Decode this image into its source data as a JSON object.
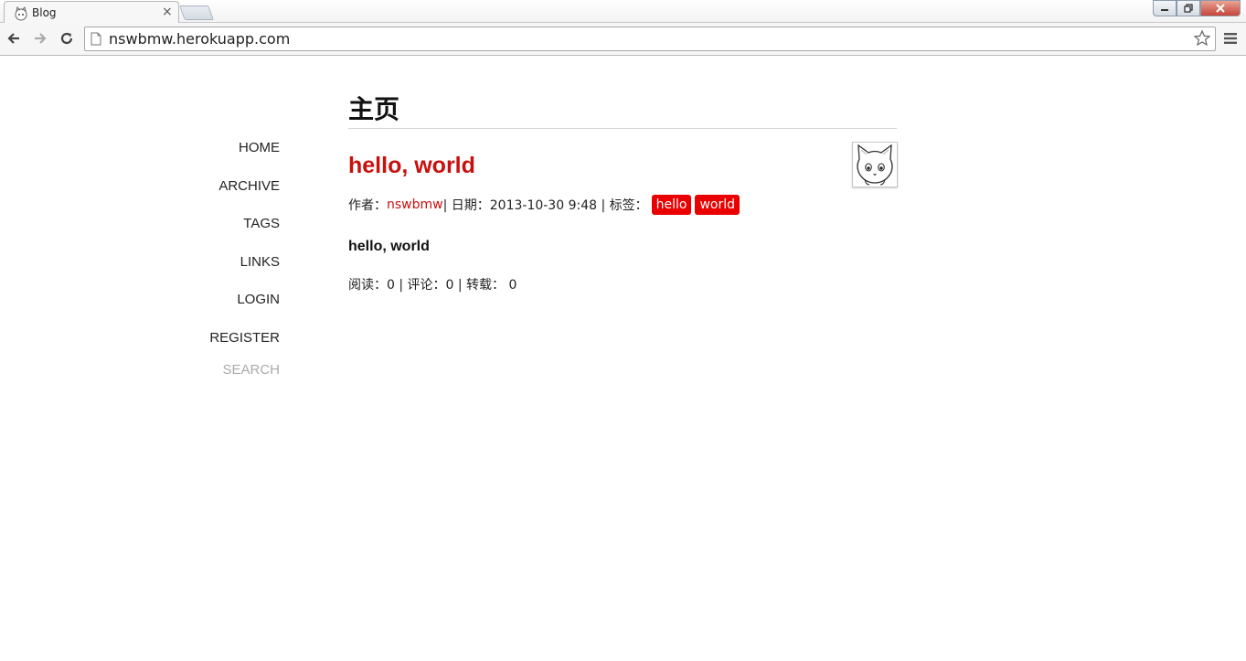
{
  "browser": {
    "tab_title": "Blog",
    "tab_close": "×",
    "url": "nswbmw.herokuapp.com",
    "window_buttons": [
      "minimize",
      "restore",
      "close"
    ]
  },
  "sidebar": {
    "items": [
      {
        "label": "HOME"
      },
      {
        "label": "ARCHIVE"
      },
      {
        "label": "TAGS"
      },
      {
        "label": "LINKS"
      },
      {
        "label": "LOGIN"
      },
      {
        "label": "REGISTER"
      }
    ],
    "search_placeholder": "SEARCH"
  },
  "main": {
    "page_title": "主页",
    "post": {
      "title": "hello, world",
      "meta": {
        "author_label": "作者：",
        "author": "nswbmw",
        "date_text": " | 日期：2013-10-30 9:48 | 标签：",
        "tags": [
          "hello",
          "world"
        ]
      },
      "body": "hello, world",
      "stats": "阅读：0 | 评论：0 | 转载： 0"
    }
  },
  "colors": {
    "accent": "#c8100e",
    "tag_bg": "#e90000",
    "muted": "#aaaaaa"
  },
  "icons": [
    "favicon-cat-icon",
    "back-arrow-icon",
    "forward-arrow-icon",
    "reload-icon",
    "page-icon",
    "star-icon",
    "menu-icon",
    "avatar-cat-image"
  ]
}
